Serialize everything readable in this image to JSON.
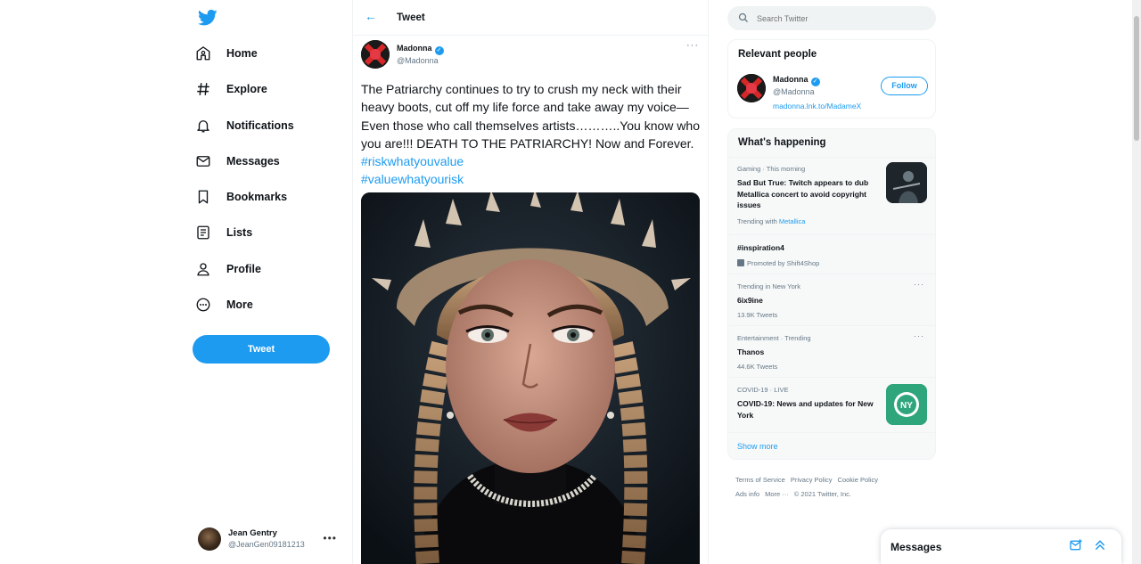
{
  "nav": {
    "items": [
      {
        "label": "Home",
        "icon": "home-icon"
      },
      {
        "label": "Explore",
        "icon": "hashtag-icon"
      },
      {
        "label": "Notifications",
        "icon": "bell-icon"
      },
      {
        "label": "Messages",
        "icon": "envelope-icon"
      },
      {
        "label": "Bookmarks",
        "icon": "bookmark-icon"
      },
      {
        "label": "Lists",
        "icon": "list-icon"
      },
      {
        "label": "Profile",
        "icon": "person-icon"
      },
      {
        "label": "More",
        "icon": "more-circle-icon"
      }
    ],
    "tweet_button": "Tweet"
  },
  "account": {
    "name": "Jean Gentry",
    "handle": "@JeanGen09181213"
  },
  "tweet": {
    "header_title": "Tweet",
    "author_name": "Madonna",
    "author_handle": "@Madonna",
    "text": "The Patriarchy continues to try to crush my neck with their heavy boots, cut off my life force and take away my voice—Even those who call themselves artists………..You know who you are!!! DEATH TO THE PATRIARCHY! Now and Forever. ",
    "hashtag1": "#riskwhatyouvalue",
    "hashtag2": "#valuewhatyourisk"
  },
  "search": {
    "placeholder": "Search Twitter"
  },
  "relevant": {
    "title": "Relevant people",
    "name": "Madonna",
    "handle": "@Madonna",
    "link": "madonna.lnk.to/MadameX",
    "follow_label": "Follow"
  },
  "happening": {
    "title": "What's happening",
    "trends": [
      {
        "meta": "Gaming · This morning",
        "title": "Sad But True: Twitch appears to dub Metallica concert to avoid copyright issues",
        "sub_prefix": "Trending with ",
        "sub_link": "Metallica"
      },
      {
        "meta": "",
        "title": "#inspiration4",
        "sub": "Promoted by Shift4Shop"
      },
      {
        "meta": "Trending in New York",
        "title": "6ix9ine",
        "sub": "13.9K Tweets"
      },
      {
        "meta": "Entertainment · Trending",
        "title": "Thanos",
        "sub": "44.6K Tweets"
      },
      {
        "meta": "COVID-19 · LIVE",
        "title": "COVID-19: News and updates for New York",
        "thumb_text": "NY"
      }
    ],
    "show_more": "Show more"
  },
  "footer": {
    "links": [
      "Terms of Service",
      "Privacy Policy",
      "Cookie Policy",
      "Ads info",
      "More ···"
    ],
    "copyright": "© 2021 Twitter, Inc."
  },
  "messages_drawer": {
    "title": "Messages"
  },
  "colors": {
    "accent": "#1d9bf0",
    "text": "#0f1419",
    "muted": "#657786"
  }
}
